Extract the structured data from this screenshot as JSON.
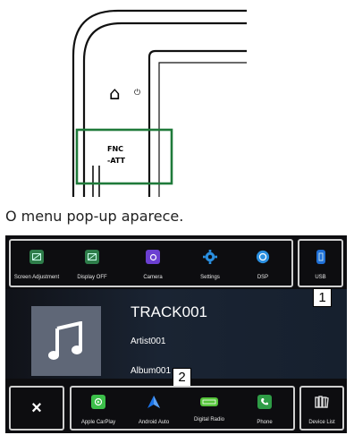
{
  "hardware": {
    "home_label": "⌂",
    "power_label": "⏻",
    "fnc_line1": "FNC",
    "fnc_line2": "-ATT"
  },
  "caption": "O menu pop-up aparece.",
  "menu_top": {
    "items": [
      {
        "label": "Screen Adjustment",
        "icon": "screen-adjust-icon",
        "color": "#2e7d4a"
      },
      {
        "label": "Display OFF",
        "icon": "display-off-icon",
        "color": "#2e7d4a"
      },
      {
        "label": "Camera",
        "icon": "camera-icon",
        "color": "#6b3fd1"
      },
      {
        "label": "Settings",
        "icon": "gear-icon",
        "color": "#2a8fe0"
      },
      {
        "label": "DSP",
        "icon": "dsp-icon",
        "color": "#2a8fe0"
      }
    ],
    "usb": {
      "label": "USB",
      "icon": "usb-icon",
      "color": "#1f6fd6"
    }
  },
  "callouts": {
    "one": "1",
    "two": "2"
  },
  "now_playing": {
    "track": "TRACK001",
    "artist": "Artist001",
    "album": "Album001"
  },
  "menu_bottom": {
    "close_icon": "×",
    "items": [
      {
        "label": "Apple CarPlay",
        "icon": "carplay-icon",
        "color": "#3cbf4a"
      },
      {
        "label": "Android Auto",
        "icon": "android-auto-icon",
        "color": "#1a73e8"
      },
      {
        "label": "Digital Radio",
        "icon": "dab-icon",
        "color": "#55c43a"
      },
      {
        "label": "Phone",
        "icon": "phone-icon",
        "color": "#2e9c46"
      }
    ],
    "device_list": {
      "label": "Device List",
      "icon": "device-list-icon"
    }
  }
}
